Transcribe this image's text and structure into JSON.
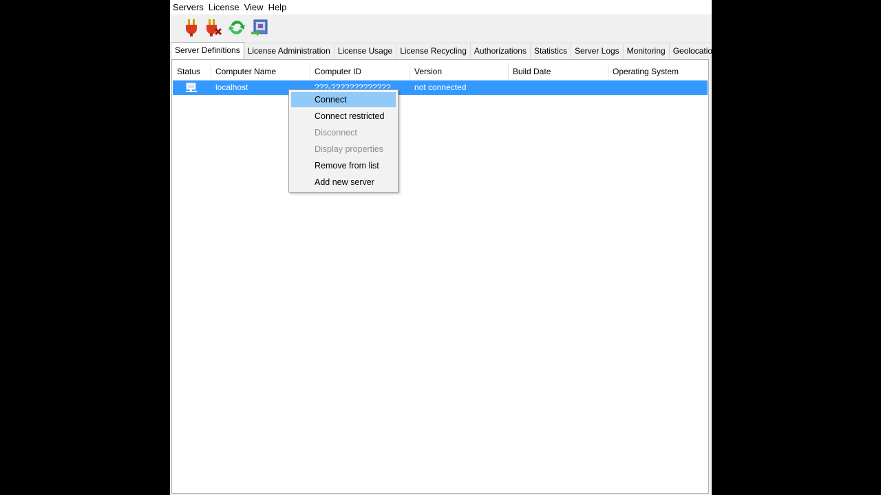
{
  "menubar": {
    "items": [
      "Servers",
      "License",
      "View",
      "Help"
    ]
  },
  "toolbar": {
    "buttons": [
      "connect-plug-icon",
      "disconnect-plug-icon",
      "refresh-icon",
      "properties-icon"
    ]
  },
  "tabs": [
    {
      "label": "Server Definitions",
      "active": true
    },
    {
      "label": "License Administration"
    },
    {
      "label": "License Usage"
    },
    {
      "label": "License Recycling"
    },
    {
      "label": "Authorizations"
    },
    {
      "label": "Statistics"
    },
    {
      "label": "Server Logs"
    },
    {
      "label": "Monitoring"
    },
    {
      "label": "Geolocation"
    }
  ],
  "table": {
    "columns": [
      "Status",
      "Computer Name",
      "Computer ID",
      "Version",
      "Build Date",
      "Operating System"
    ],
    "rows": [
      {
        "status_icon": "computer-icon",
        "computer_name": "localhost",
        "computer_id": "???-?????????????",
        "version": "not connected",
        "build_date": "",
        "os": ""
      }
    ]
  },
  "context_menu": {
    "items": [
      {
        "label": "Connect",
        "state": "hover"
      },
      {
        "label": "Connect restricted"
      },
      {
        "label": "Disconnect",
        "state": "disabled"
      },
      {
        "label": "Display properties",
        "state": "disabled"
      },
      {
        "label": "Remove from list"
      },
      {
        "label": "Add new server"
      }
    ]
  },
  "colors": {
    "selection": "#3399ff",
    "menu_hover": "#91c9f7",
    "disabled_text": "#8c8c8c"
  }
}
